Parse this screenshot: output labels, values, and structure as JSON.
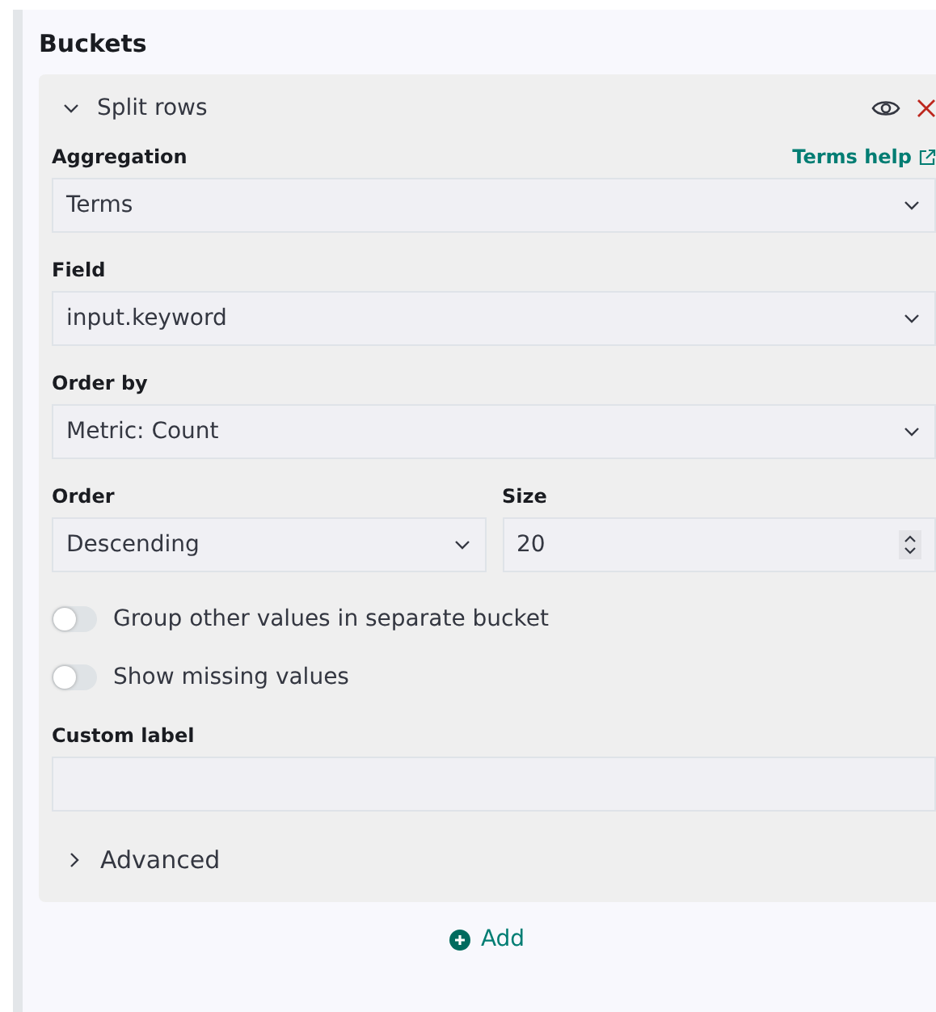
{
  "title": "Buckets",
  "bucket": {
    "title": "Split rows",
    "expanded": true,
    "aggregation": {
      "label": "Aggregation",
      "help_link": "Terms help",
      "value": "Terms"
    },
    "field": {
      "label": "Field",
      "value": "input.keyword"
    },
    "order_by": {
      "label": "Order by",
      "value": "Metric: Count"
    },
    "order": {
      "label": "Order",
      "value": "Descending"
    },
    "size": {
      "label": "Size",
      "value": "20"
    },
    "toggles": [
      {
        "label": "Group other values in separate bucket",
        "on": false
      },
      {
        "label": "Show missing values",
        "on": false
      }
    ],
    "custom_label": {
      "label": "Custom label"
    },
    "advanced": {
      "label": "Advanced",
      "expanded": false
    }
  },
  "add_button": "Add"
}
